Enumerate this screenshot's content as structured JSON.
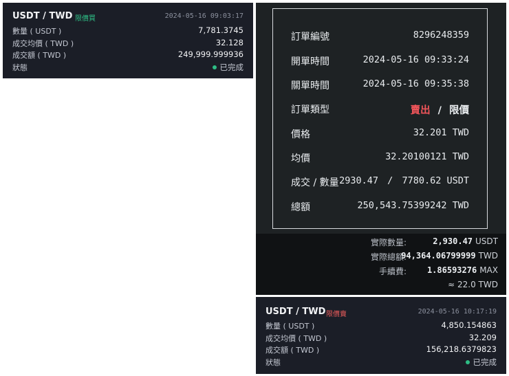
{
  "card1": {
    "pair": "USDT / TWD",
    "order_type": "限價買",
    "timestamp": "2024-05-16 09:03:17",
    "rows": [
      {
        "label": "數量 ( USDT )",
        "value": "7,781.3745"
      },
      {
        "label": "成交均價 ( TWD )",
        "value": "32.128"
      },
      {
        "label": "成交額 ( TWD )",
        "value": "249,999.999936"
      },
      {
        "label": "狀態",
        "value": "已完成"
      }
    ],
    "status_color": "#2ebd85"
  },
  "detail": {
    "rows": [
      {
        "label": "訂單編號",
        "value": "8296248359"
      },
      {
        "label": "開單時間",
        "value": "2024-05-16 09:33:24"
      },
      {
        "label": "關單時間",
        "value": "2024-05-16 09:35:38"
      },
      {
        "label": "訂單類型",
        "side": "賣出",
        "sep": "/",
        "kind": "限價"
      },
      {
        "label": "價格",
        "value": "32.201 TWD"
      },
      {
        "label": "均價",
        "value": "32.20100121 TWD"
      },
      {
        "label": "成交 / 數量",
        "filled": "2930.47",
        "sep": "/",
        "amount": "7780.62 USDT"
      },
      {
        "label": "總額",
        "value": "250,543.75399242 TWD"
      }
    ],
    "sell_color": "#f0555a"
  },
  "fees": {
    "rows": [
      {
        "label": "實際數量:",
        "value": "2,930.47",
        "unit": "USDT"
      },
      {
        "label": "實際總額:",
        "value": "94,364.06799999",
        "unit": "TWD"
      },
      {
        "label": "手續費:",
        "value": "1.86593276",
        "unit": "MAX"
      }
    ],
    "approx": "≈ 22.0 TWD"
  },
  "card3": {
    "pair": "USDT / TWD",
    "order_type": "限價賣",
    "timestamp": "2024-05-16 10:17:19",
    "rows": [
      {
        "label": "數量 ( USDT )",
        "value": "4,850.154863"
      },
      {
        "label": "成交均價 ( TWD )",
        "value": "32.209"
      },
      {
        "label": "成交額 ( TWD )",
        "value": "156,218.6379823"
      },
      {
        "label": "狀態",
        "value": "已完成"
      }
    ],
    "status_color": "#2ebd85"
  }
}
